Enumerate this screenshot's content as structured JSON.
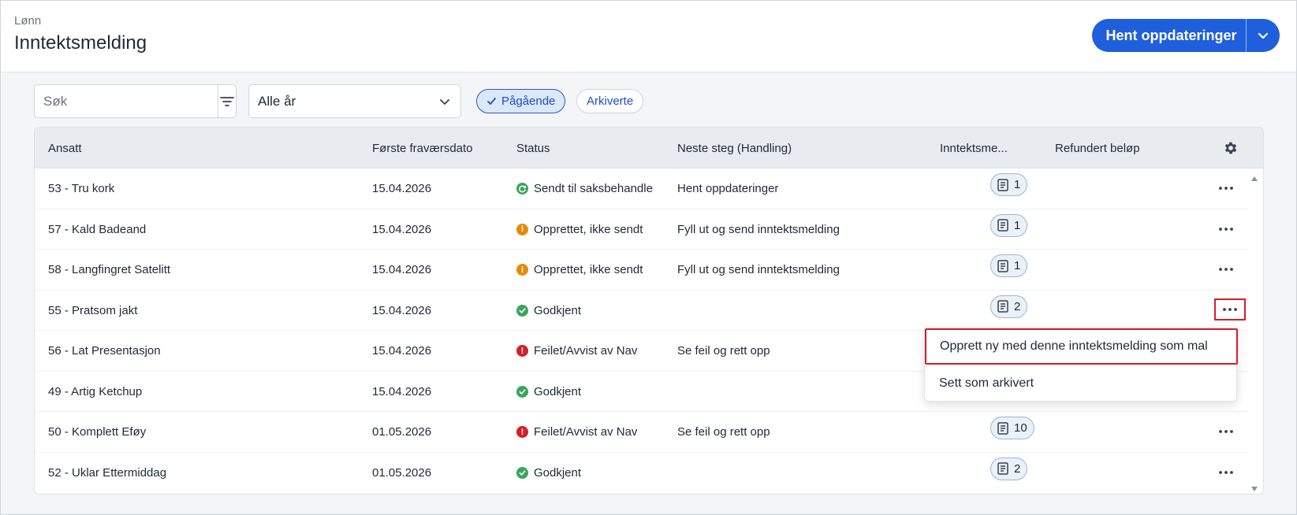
{
  "header": {
    "breadcrumb": "Lønn",
    "title": "Inntektsmelding",
    "primary_button": "Hent oppdateringer"
  },
  "toolbar": {
    "search_placeholder": "Søk",
    "year_select": "Alle år",
    "chips": [
      {
        "label": "Pågående",
        "active": true
      },
      {
        "label": "Arkiverte",
        "active": false
      }
    ]
  },
  "table": {
    "columns": [
      "Ansatt",
      "Første fraværsdato",
      "Status",
      "Neste steg (Handling)",
      "Inntektsme...",
      "Refundert beløp"
    ],
    "rows": [
      {
        "ansatt": "53 - Tru kork",
        "dato": "15.04.2026",
        "status": "Sendt til saksbehandle",
        "status_type": "sent",
        "neste": "Hent oppdateringer",
        "count": "1"
      },
      {
        "ansatt": "57 - Kald Badeand",
        "dato": "15.04.2026",
        "status": "Opprettet, ikke sendt",
        "status_type": "warning",
        "neste": "Fyll ut og send inntektsmelding",
        "count": "1"
      },
      {
        "ansatt": "58 - Langfingret Satelitt",
        "dato": "15.04.2026",
        "status": "Opprettet, ikke sendt",
        "status_type": "warning",
        "neste": "Fyll ut og send inntektsmelding",
        "count": "1"
      },
      {
        "ansatt": "55 - Pratsom jakt",
        "dato": "15.04.2026",
        "status": "Godkjent",
        "status_type": "success",
        "neste": "",
        "count": "2"
      },
      {
        "ansatt": "56 - Lat Presentasjon",
        "dato": "15.04.2026",
        "status": "Feilet/Avvist av Nav",
        "status_type": "error",
        "neste": "Se feil og rett opp",
        "count": ""
      },
      {
        "ansatt": "49 - Artig Ketchup",
        "dato": "15.04.2026",
        "status": "Godkjent",
        "status_type": "success",
        "neste": "",
        "count": ""
      },
      {
        "ansatt": "50 - Komplett Eføy",
        "dato": "01.05.2026",
        "status": "Feilet/Avvist av Nav",
        "status_type": "error",
        "neste": "Se feil og rett opp",
        "count": "10"
      },
      {
        "ansatt": "52 - Uklar Ettermiddag",
        "dato": "01.05.2026",
        "status": "Godkjent",
        "status_type": "success",
        "neste": "",
        "count": "2"
      }
    ]
  },
  "context_menu": {
    "items": [
      "Opprett ny med denne inntektsmelding som mal",
      "Sett som arkivert"
    ]
  },
  "colors": {
    "primary": "#1f5fdc",
    "success": "#3aa55d",
    "warning": "#e8890c",
    "error": "#d21f2a",
    "highlight": "#d21f2a"
  },
  "icons": [
    "filter-icon",
    "chevron-down-icon",
    "check-icon",
    "gear-icon",
    "document-icon",
    "more-icon",
    "scroll-up-icon",
    "scroll-down-icon"
  ]
}
